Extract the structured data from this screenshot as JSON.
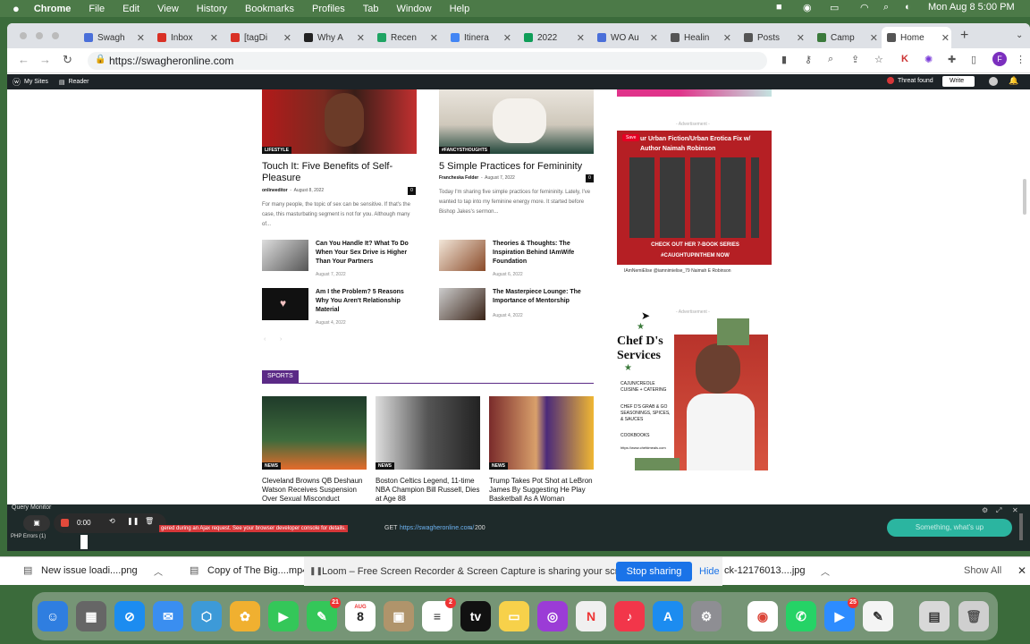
{
  "menubar": {
    "apple": "",
    "app": "Chrome",
    "items": [
      "File",
      "Edit",
      "View",
      "History",
      "Bookmarks",
      "Profiles",
      "Tab",
      "Window",
      "Help"
    ],
    "clock": "Mon Aug 8  5:00 PM"
  },
  "tabs": [
    {
      "label": "Swagh",
      "color": "#4a6fd9"
    },
    {
      "label": "Inbox",
      "color": "#d93025"
    },
    {
      "label": "[tagDi",
      "color": "#d93025"
    },
    {
      "label": "Why A",
      "color": "#222"
    },
    {
      "label": "Recen",
      "color": "#1fa463"
    },
    {
      "label": "Itinera",
      "color": "#4285f4"
    },
    {
      "label": "2022",
      "color": "#0f9d58"
    },
    {
      "label": "WO Au",
      "color": "#4a6fd9"
    },
    {
      "label": "Healin",
      "color": "#555"
    },
    {
      "label": "Posts",
      "color": "#555"
    },
    {
      "label": "Camp",
      "color": "#3b7a3b"
    },
    {
      "label": "Home",
      "color": "#555"
    }
  ],
  "url": "https://swagheronline.com",
  "wpbar": {
    "sites": "My Sites",
    "reader": "Reader",
    "threat": "Threat found",
    "write": "Write"
  },
  "articles": {
    "a1": {
      "cat": "LIFESTYLE",
      "title": "Touch It: Five Benefits of Self-Pleasure",
      "author": "onlineeditor",
      "date": "August 8, 2022",
      "count": "0",
      "excerpt": "For many people, the topic of sex can be sensitive. If that's the case, this masturbating segment is not for you. Although many of..."
    },
    "a2": {
      "cat": "#FANCYSTHOUGHTS",
      "title": "5 Simple Practices for Femininity",
      "author": "Francheska Felder",
      "date": "August 7, 2022",
      "count": "0",
      "excerpt": "Today I'm sharing five simple practices for femininity. Lately, I've wanted to tap into my feminine energy more. It started before Bishop Jakes's sermon..."
    },
    "s1": {
      "title": "Can You Handle It? What To Do When Your Sex Drive is Higher Than Your Partners",
      "date": "August 7, 2022"
    },
    "s2": {
      "title": "Theories & Thoughts: The Inspiration Behind IAmWife Foundation",
      "date": "August 6, 2022"
    },
    "s3": {
      "title": "Am I the Problem? 5 Reasons Why You Aren't Relationship Material",
      "date": "August 4, 2022"
    },
    "s4": {
      "title": "The Masterpiece Lounge: The Importance of Mentorship",
      "date": "August 4, 2022"
    }
  },
  "sports": {
    "label": "SPORTS",
    "items": [
      {
        "cat": "NEWS",
        "title": "Cleveland Browns QB Deshaun Watson Receives Suspension Over Sexual Misconduct"
      },
      {
        "cat": "NEWS",
        "title": "Boston Celtics Legend, 11-time NBA Champion Bill Russell, Dies at Age 88"
      },
      {
        "cat": "NEWS",
        "title": "Trump Takes Pot Shot at LeBron James By Suggesting He Play Basketball As A Woman"
      }
    ]
  },
  "ads": {
    "label": "- Advertisement -",
    "ad1": {
      "save": "Save",
      "title": "ur Urban Fiction/Urban Erotica Fix w/ Author Naimah Robinson",
      "cta": "CHECK OUT HER 7-BOOK SERIES #CAUGHTUPINTHEM NOW",
      "handles": "IAmNemiElise   @iamnimielise_79   Naimah E Robinson"
    },
    "ad2": {
      "title": "Chef D's Services",
      "l1": "CAJUN/CREOLE CUISINE + CATERING",
      "l2": "CHEF D'S GRAB & GO SEASONINGS, SPICES, & SAUCES",
      "l3": "COOKBOOKS",
      "url": "https://www.chefdmeals.com"
    }
  },
  "querymonitor": {
    "title": "Query Monitor",
    "timer": "0:00",
    "err": "gered during an Ajax request. See your browser developer console for details.",
    "get": "GET",
    "url": "https://swagheronline.com/",
    "status": "→ 200",
    "php": "PHP Errors (1)",
    "pill": "Something, what's up"
  },
  "downloads": {
    "items": [
      "New issue loadi....png",
      "Copy of The Big....mp4"
    ],
    "share": "Loom – Free Screen Recorder & Screen Capture is sharing your screen.",
    "stop": "Stop sharing",
    "hide": "Hide",
    "file3": "ck-12176013....jpg",
    "showall": "Show All"
  },
  "dock": {
    "calendar_month": "AUG",
    "calendar_day": "8",
    "badges": {
      "messages": "21",
      "reminders": "2",
      "zoom": "25"
    }
  }
}
